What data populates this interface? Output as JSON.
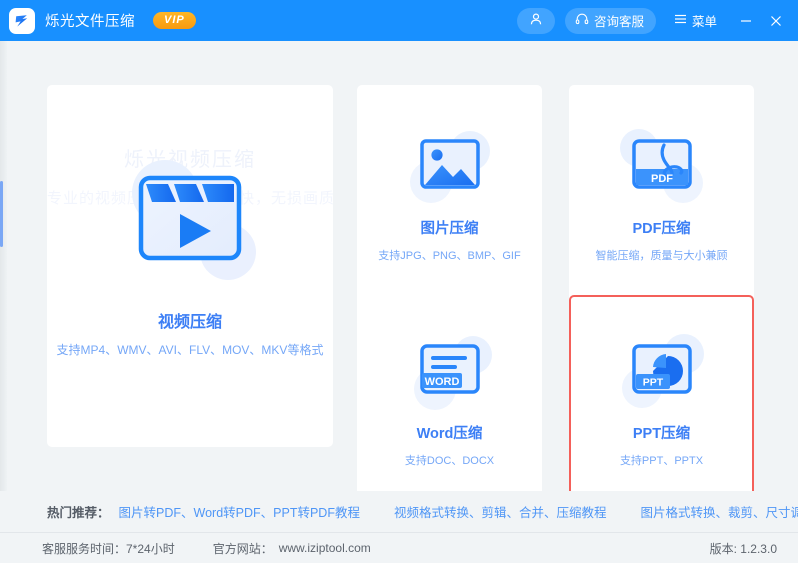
{
  "titlebar": {
    "logo_icon": "app-logo-lightning-icon",
    "app_name": "烁光文件压缩",
    "vip_label": "VIP",
    "user_icon": "user-account-icon",
    "service_icon": "headset-icon",
    "service_label": "咨询客服",
    "menu_icon": "hamburger-menu-icon",
    "menu_label": "菜单",
    "minimize_label": "−",
    "close_label": "✕",
    "accent_color": "#1890ff"
  },
  "cards": {
    "video": {
      "icon": "video-clapperboard-play-icon",
      "title": "视频压缩",
      "subtitle": "支持MP4、WMV、AVI、FLV、MOV、MKV等格式",
      "watermark_1": "烁光视频压缩",
      "watermark_2": "专业的视频压缩软件，压缩快，无损画质"
    },
    "image": {
      "icon": "picture-mountain-icon",
      "title": "图片压缩",
      "subtitle": "支持JPG、PNG、BMP、GIF"
    },
    "pdf": {
      "icon": "pdf-document-icon",
      "title": "PDF压缩",
      "subtitle": "智能压缩，质量与大小兼顾"
    },
    "word": {
      "icon": "word-document-icon",
      "title": "Word压缩",
      "subtitle": "支持DOC、DOCX"
    },
    "ppt": {
      "icon": "ppt-piechart-icon",
      "title": "PPT压缩",
      "subtitle": "支持PPT、PPTX",
      "selected": true,
      "highlight_color": "#f4605a"
    }
  },
  "recommend": {
    "label": "热门推荐：",
    "link_1": "图片转PDF、Word转PDF、PPT转PDF教程",
    "link_2": "视频格式转换、剪辑、合并、压缩教程",
    "link_3": "图片格式转换、裁剪、尺寸调整、证件照大小调整"
  },
  "footer": {
    "hours_label": "客服服务时间：7*24小时",
    "site_label": "官方网站：",
    "site_url": "www.iziptool.com",
    "version": "版本: 1.2.3.0"
  }
}
